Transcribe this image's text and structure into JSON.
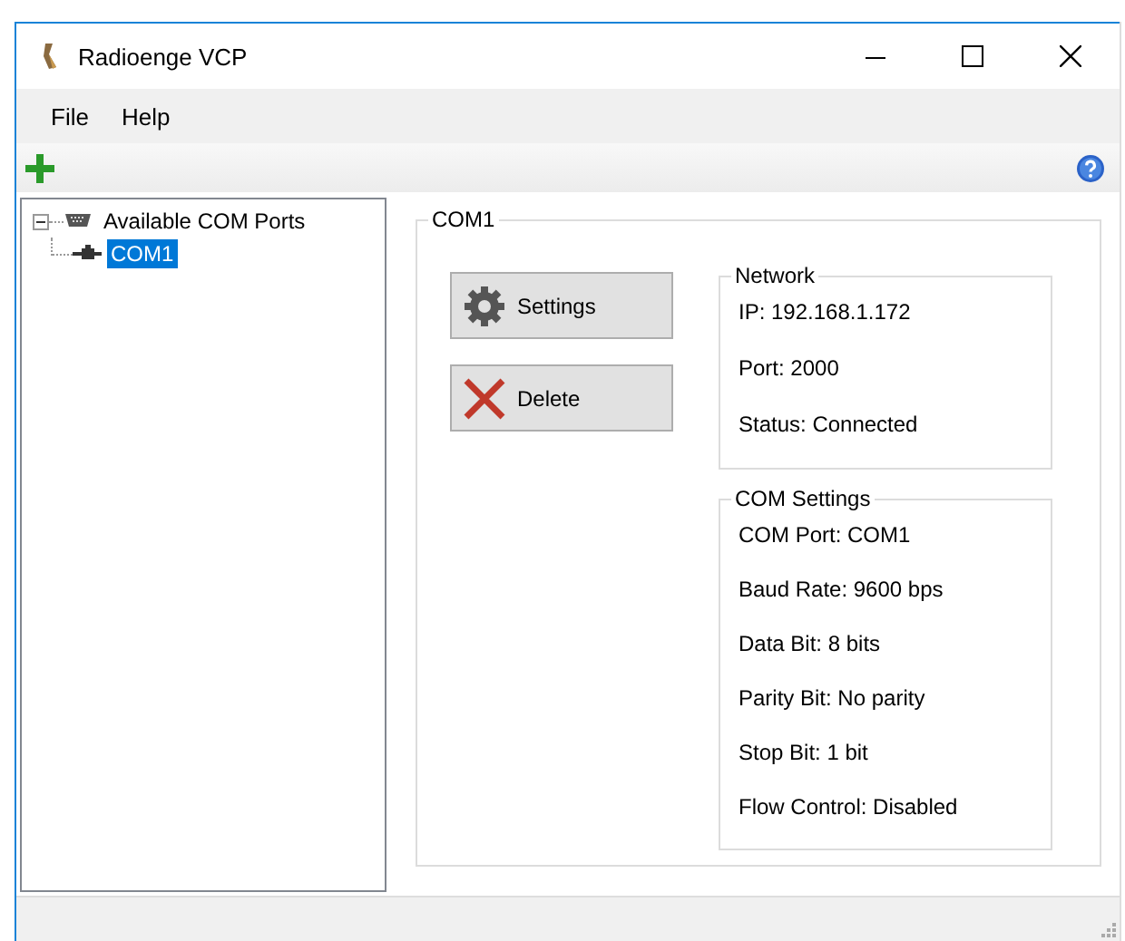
{
  "window": {
    "title": "Radioenge VCP"
  },
  "menu": [
    "File",
    "Help"
  ],
  "tree": {
    "label": "Available COM Ports",
    "expanded": true,
    "children": [
      {
        "label": "COM1",
        "selected": true
      }
    ]
  },
  "panel": {
    "title": "COM1",
    "buttons": [
      {
        "kind": "settings",
        "label": "Settings"
      },
      {
        "kind": "delete",
        "label": "Delete"
      }
    ],
    "groups": [
      {
        "title": "Network",
        "lines": [
          "IP: 192.168.1.172",
          "Port: 2000",
          "Status: Connected"
        ]
      },
      {
        "title": "COM Settings",
        "lines": [
          "COM Port: COM1",
          "Baud Rate: 9600 bps",
          "Data Bit: 8 bits",
          "Parity Bit: No parity",
          "Stop Bit: 1 bit",
          "Flow Control: Disabled"
        ]
      }
    ]
  }
}
